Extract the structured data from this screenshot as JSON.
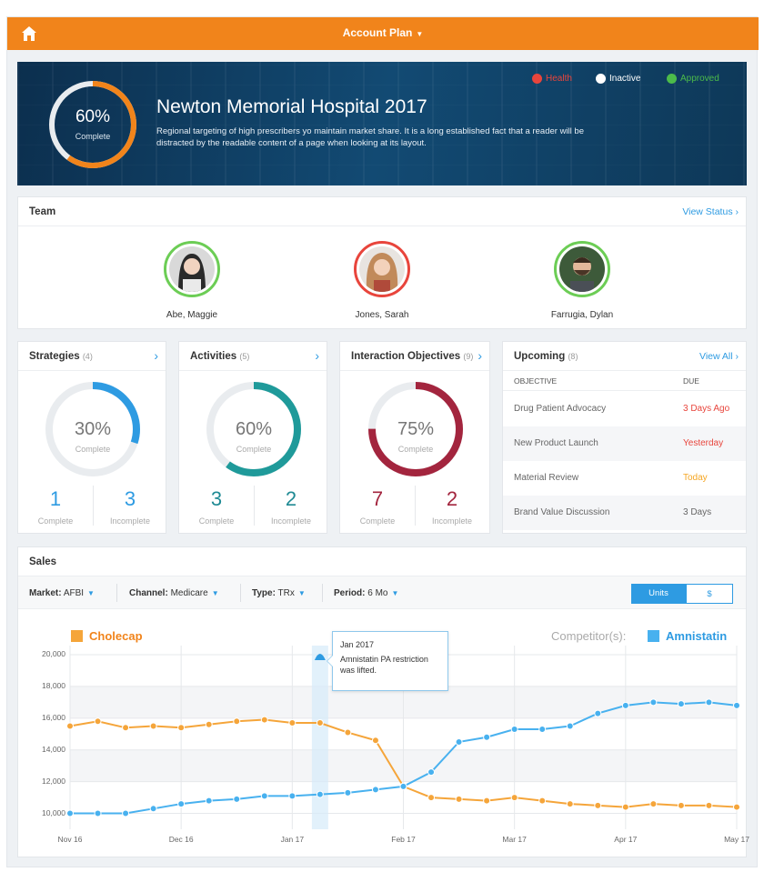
{
  "topbar": {
    "title": "Account Plan",
    "home_icon": "home-icon"
  },
  "hero": {
    "percent": "60%",
    "percent_label": "Complete",
    "progress": 0.6,
    "title": "Newton Memorial Hospital 2017",
    "description": "Regional targeting of high prescribers yo maintain market share. It is a long established fact that a reader will be distracted by the readable content of a page when looking at its layout.",
    "statuses": [
      {
        "label": "Health",
        "color": "#e8453c",
        "icon": "alert-icon"
      },
      {
        "label": "Inactive",
        "color": "#ffffff",
        "icon": "inactive-icon"
      },
      {
        "label": "Approved",
        "color": "#4cbb4a",
        "icon": "check-icon"
      }
    ]
  },
  "team": {
    "title": "Team",
    "link": "View Status",
    "members": [
      {
        "name": "Abe, Maggie",
        "ring_color": "#6ccd55"
      },
      {
        "name": "Jones, Sarah",
        "ring_color": "#e8453c"
      },
      {
        "name": "Farrugia, Dylan",
        "ring_color": "#6ccd55"
      }
    ]
  },
  "strategies": {
    "title": "Strategies",
    "count": "(4)",
    "percent": "30%",
    "label": "Complete",
    "progress": 0.3,
    "color": "#2e9be2",
    "complete": "1",
    "incomplete": "3",
    "complete_label": "Complete",
    "incomplete_label": "Incomplete"
  },
  "activities": {
    "title": "Activities",
    "count": "(5)",
    "percent": "60%",
    "label": "Complete",
    "progress": 0.6,
    "color": "#1f9a9a",
    "complete": "3",
    "incomplete": "2",
    "complete_label": "Complete",
    "incomplete_label": "Incomplete"
  },
  "interactions": {
    "title": "Interaction Objectives",
    "count": "(9)",
    "percent": "75%",
    "label": "Complete",
    "progress": 0.75,
    "color": "#a3253e",
    "complete": "7",
    "incomplete": "2",
    "complete_label": "Complete",
    "incomplete_label": "Incomplete"
  },
  "upcoming": {
    "title": "Upcoming",
    "count": "(8)",
    "link": "View All",
    "col_objective": "OBJECTIVE",
    "col_due": "DUE",
    "rows": [
      {
        "objective": "Drug Patient Advocacy",
        "due": "3 Days Ago",
        "color": "#e8453c"
      },
      {
        "objective": "New Product Launch",
        "due": "Yesterday",
        "color": "#e8453c"
      },
      {
        "objective": "Material Review",
        "due": "Today",
        "color": "#f5a623"
      },
      {
        "objective": "Brand Value Discussion",
        "due": "3 Days",
        "color": "#666666"
      }
    ]
  },
  "sales": {
    "title": "Sales",
    "filters": [
      {
        "label": "Market:",
        "value": "AFBI"
      },
      {
        "label": "Channel:",
        "value": "Medicare"
      },
      {
        "label": "Type:",
        "value": "TRx"
      },
      {
        "label": "Period:",
        "value": "6 Mo"
      }
    ],
    "toggle": [
      "Units",
      "$"
    ],
    "competitor_label": "Competitor(s):",
    "tooltip": {
      "date": "Jan 2017",
      "text": "Amnistatin PA restriction was lifted."
    }
  },
  "chart_data": {
    "type": "line",
    "x": [
      "Nov 16",
      "Dec 16",
      "Jan 17",
      "Feb 17",
      "Mar 17",
      "Apr 17",
      "May 17"
    ],
    "y_ticks": [
      "20,000",
      "18,000",
      "16,000",
      "14,000",
      "12,000",
      "10,000"
    ],
    "ylim": [
      9000,
      20000
    ],
    "series": [
      {
        "name": "Cholecap",
        "color": "#f5a53a",
        "values": [
          15500,
          15800,
          15400,
          15500,
          15400,
          15600,
          15800,
          15900,
          15700,
          15700,
          15100,
          14600,
          11700,
          11000,
          10900,
          10800,
          11000,
          10800,
          10600,
          10500,
          10400,
          10600,
          10500,
          10500,
          10400
        ]
      },
      {
        "name": "Amnistatin",
        "color": "#48b1ef",
        "values": [
          10000,
          10000,
          10000,
          10300,
          10600,
          10800,
          10900,
          11100,
          11100,
          11200,
          11300,
          11500,
          11700,
          12600,
          14500,
          14800,
          15300,
          15300,
          15500,
          16300,
          16800,
          17000,
          16900,
          17000,
          16800
        ]
      }
    ]
  }
}
